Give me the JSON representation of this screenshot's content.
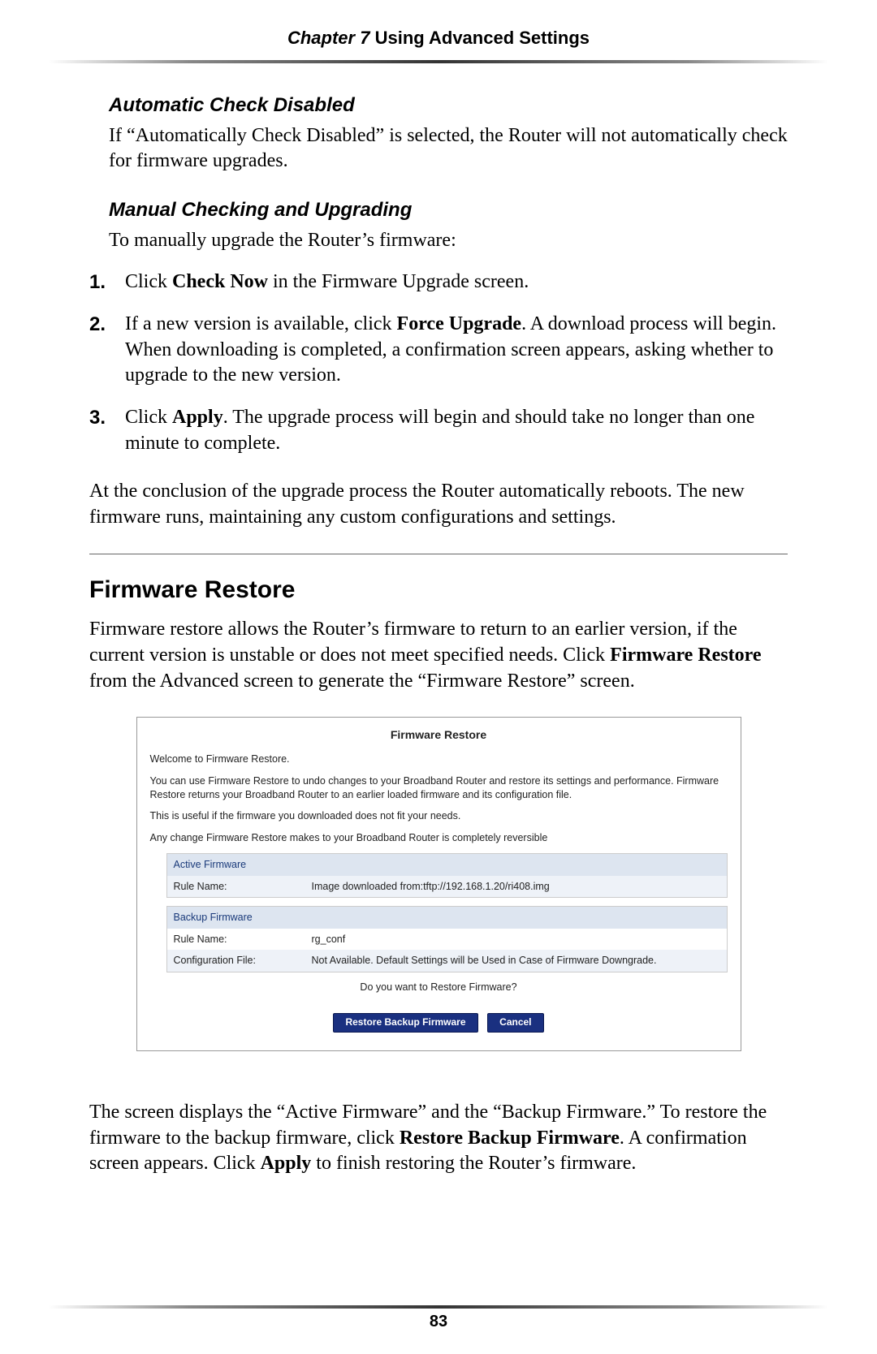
{
  "header": {
    "chapter": "Chapter 7",
    "title": "Using Advanced Settings"
  },
  "section1": {
    "heading": "Automatic Check Disabled",
    "para": "If “Automatically Check Disabled” is selected, the Router will not automatically check for firmware upgrades."
  },
  "section2": {
    "heading": "Manual Checking and Upgrading",
    "intro": "To manually upgrade the Router’s firmware:",
    "steps": [
      {
        "num": "1.",
        "pre": "Click ",
        "bold": "Check Now",
        "post": " in the Firmware Upgrade screen."
      },
      {
        "num": "2.",
        "pre": "If a new version is available, click ",
        "bold": "Force Upgrade",
        "post": ". A download process will begin. When downloading is completed, a confirmation screen appears, asking whether to upgrade to the new version."
      },
      {
        "num": "3.",
        "pre": "Click ",
        "bold": "Apply",
        "post": ". The upgrade process will begin and should take no longer than one minute to complete."
      }
    ],
    "closing": "At the conclusion of the upgrade process the Router automatically reboots. The new firmware runs, maintaining any custom configurations and settings."
  },
  "section3": {
    "heading": "Firmware Restore",
    "intro_pre": "Firmware restore allows the Router’s firmware to return to an earlier version, if the current version is unstable or does not meet specified needs. Click ",
    "intro_bold": "Firmware Restore",
    "intro_post": " from the Advanced screen to generate the “Firmware Restore” screen."
  },
  "screenshot": {
    "title": "Firmware Restore",
    "welcome": "Welcome to Firmware Restore.",
    "desc1": "You can use Firmware Restore to undo changes to your Broadband Router and restore its settings and performance. Firmware Restore returns your Broadband Router to an earlier loaded firmware and its configuration file.",
    "desc2": "This is useful if the firmware you downloaded does not fit your needs.",
    "desc3": "Any change Firmware Restore makes to your Broadband Router is completely reversible",
    "active": {
      "header": "Active Firmware",
      "rule_label": "Rule Name:",
      "rule_value": "Image downloaded from:tftp://192.168.1.20/ri408.img"
    },
    "backup": {
      "header": "Backup Firmware",
      "rule_label": "Rule Name:",
      "rule_value": "rg_conf",
      "config_label": "Configuration File:",
      "config_value": "Not Available. Default Settings will be Used in Case of Firmware Downgrade."
    },
    "prompt": "Do you want to Restore Firmware?",
    "btn_restore": "Restore Backup Firmware",
    "btn_cancel": "Cancel"
  },
  "closing_para": {
    "t1": "The screen displays the “Active Firmware” and the “Backup Firmware.” To restore the firmware to the backup firmware, click ",
    "b1": "Restore Backup Firmware",
    "t2": ". A confirmation screen appears. Click ",
    "b2": "Apply",
    "t3": " to finish restoring the Router’s firmware."
  },
  "page_number": "83"
}
